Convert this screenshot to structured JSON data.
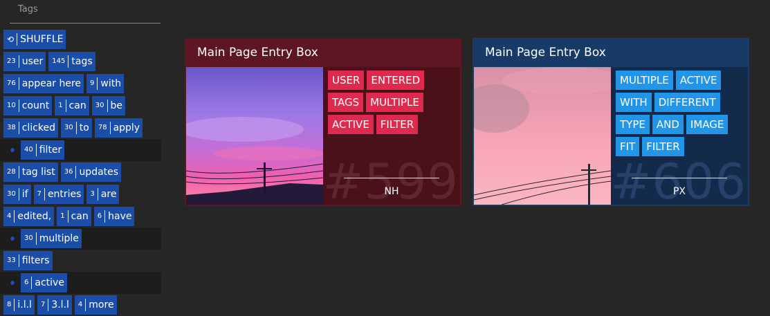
{
  "sidebar": {
    "title": "Tags",
    "shuffle": {
      "icon": "shuffle-icon",
      "label": "SHUFFLE"
    },
    "rows": [
      [
        {
          "count": "23",
          "label": "user"
        },
        {
          "count": "145",
          "label": "tags"
        }
      ],
      [
        {
          "count": "76",
          "label": "appear here"
        },
        {
          "count": "9",
          "label": "with"
        }
      ],
      [
        {
          "count": "10",
          "label": "count"
        },
        {
          "count": "1",
          "label": "can"
        },
        {
          "count": "30",
          "label": "be"
        }
      ],
      [
        {
          "count": "38",
          "label": "clicked"
        },
        {
          "count": "30",
          "label": "to"
        },
        {
          "count": "78",
          "label": "apply"
        }
      ],
      [
        {
          "count": "40",
          "label": "filter"
        }
      ],
      [
        {
          "count": "28",
          "label": "tag list"
        },
        {
          "count": "36",
          "label": "updates"
        }
      ],
      [
        {
          "count": "30",
          "label": "if"
        },
        {
          "count": "7",
          "label": "entries"
        },
        {
          "count": "3",
          "label": "are"
        }
      ],
      [
        {
          "count": "4",
          "label": "edited,"
        },
        {
          "count": "1",
          "label": "can"
        },
        {
          "count": "6",
          "label": "have"
        }
      ],
      [
        {
          "count": "30",
          "label": "multiple"
        }
      ],
      [
        {
          "count": "33",
          "label": "filters"
        }
      ],
      [
        {
          "count": "6",
          "label": "active"
        }
      ],
      [
        {
          "count": "8",
          "label": "i.l.l"
        },
        {
          "count": "7",
          "label": "3.l.l"
        },
        {
          "count": "4",
          "label": "more"
        }
      ]
    ]
  },
  "entries": [
    {
      "title": "Main Page Entry Box",
      "tags": [
        "USER",
        "ENTERED",
        "TAGS",
        "MULTIPLE",
        "ACTIVE",
        "FILTER"
      ],
      "number": "#599",
      "initials": "NH",
      "accent": "#e0294f"
    },
    {
      "title": "Main Page Entry Box",
      "tags": [
        "MULTIPLE",
        "ACTIVE",
        "WITH",
        "DIFFERENT",
        "TYPE",
        "AND",
        "IMAGE",
        "FIT",
        "FILTER"
      ],
      "number": "#606",
      "initials": "PX",
      "accent": "#2196e8"
    }
  ]
}
